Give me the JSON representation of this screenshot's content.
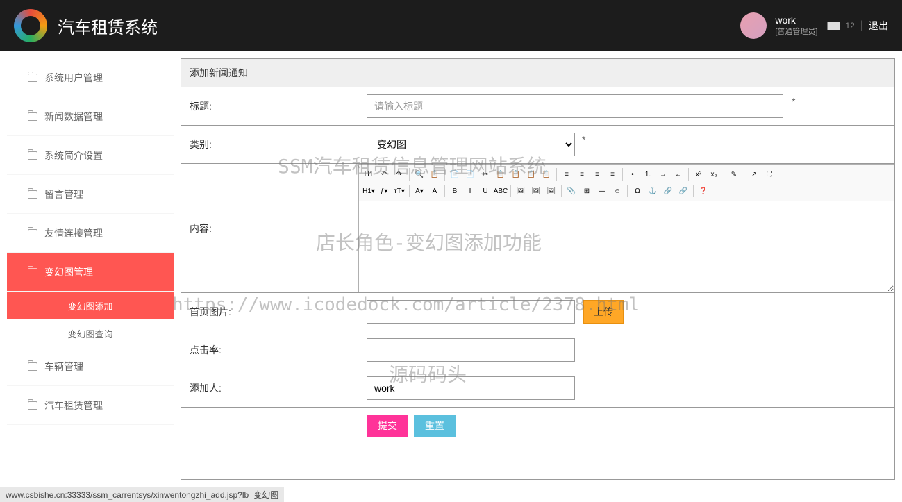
{
  "header": {
    "title": "汽车租赁系统",
    "user_name": "work",
    "user_role": "[普通管理员]",
    "msg_count": "12",
    "logout": "退出"
  },
  "sidebar": {
    "items": [
      {
        "label": "系统用户管理"
      },
      {
        "label": "新闻数据管理"
      },
      {
        "label": "系统简介设置"
      },
      {
        "label": "留言管理"
      },
      {
        "label": "友情连接管理"
      },
      {
        "label": "变幻图管理",
        "sub": [
          {
            "label": "变幻图添加"
          },
          {
            "label": "变幻图查询"
          }
        ]
      },
      {
        "label": "车辆管理"
      },
      {
        "label": "汽车租赁管理"
      }
    ]
  },
  "form": {
    "header": "添加新闻通知",
    "fields": {
      "title_label": "标题:",
      "title_placeholder": "请输入标题",
      "category_label": "类别:",
      "category_value": "变幻图",
      "content_label": "内容:",
      "image_label": "首页图片:",
      "upload_btn": "上传",
      "clicks_label": "点击率:",
      "adder_label": "添加人:",
      "adder_value": "work",
      "submit": "提交",
      "reset": "重置"
    }
  },
  "editor_toolbar": {
    "row1": [
      "H1",
      "↶",
      "↷",
      "|",
      "🔍",
      "📋",
      "|",
      "📄",
      "📄",
      "✂",
      "📋",
      "📋",
      "📋",
      "📋",
      "|",
      "≡",
      "≡",
      "≡",
      "≡",
      "|",
      "•",
      "1.",
      "→",
      "←",
      "|",
      "x²",
      "x₂",
      "|",
      "✎",
      "|",
      "↗",
      "⛶"
    ],
    "row2": [
      "H1▾",
      "ƒ▾",
      "тT▾",
      "|",
      "A▾",
      "A",
      "|",
      "B",
      "I",
      "U",
      "ABC",
      "|",
      "🖼",
      "🖼",
      "🖼",
      "|",
      "📎",
      "⊞",
      "—",
      "☺",
      "|",
      "Ω",
      "⚓",
      "🔗",
      "🔗",
      "|",
      "❓"
    ]
  },
  "watermarks": {
    "w1": "SSM汽车租赁信息管理网站系统",
    "w2": "店长角色-变幻图添加功能",
    "w3": "https://www.icodedock.com/article/2378.html",
    "w4": "源码码头"
  },
  "statusbar": "www.csbishe.cn:33333/ssm_carrentsys/xinwentongzhi_add.jsp?lb=变幻图"
}
